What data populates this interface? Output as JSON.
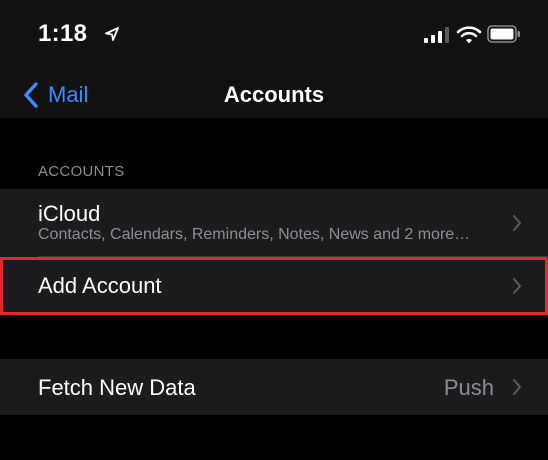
{
  "status_bar": {
    "time": "1:18",
    "icons": [
      "location-arrow-icon",
      "cellular-signal-icon",
      "wifi-icon",
      "battery-icon"
    ]
  },
  "nav": {
    "back_label": "Mail",
    "title": "Accounts"
  },
  "accounts_section": {
    "header": "ACCOUNTS",
    "items": [
      {
        "title": "iCloud",
        "subtitle": "Contacts, Calendars, Reminders, Notes, News and 2 more…"
      },
      {
        "title": "Add Account"
      }
    ]
  },
  "fetch_section": {
    "title": "Fetch New Data",
    "value": "Push"
  },
  "colors": {
    "background": "#000000",
    "cell": "#1c1c1e",
    "accent": "#3b8cff",
    "secondary_text": "#8d8d93",
    "highlight": "#e5282f"
  }
}
